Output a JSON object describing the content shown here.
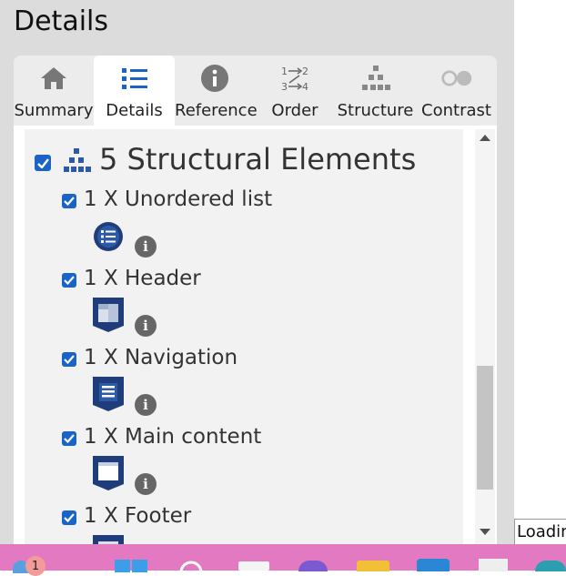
{
  "panel": {
    "title": "Details"
  },
  "tabs": [
    {
      "label": "Summary",
      "icon": "home-icon"
    },
    {
      "label": "Details",
      "icon": "list-icon",
      "active": true
    },
    {
      "label": "Reference",
      "icon": "info-icon"
    },
    {
      "label": "Order",
      "icon": "order-icon"
    },
    {
      "label": "Structure",
      "icon": "hierarchy-icon"
    },
    {
      "label": "Contrast",
      "icon": "contrast-icon"
    }
  ],
  "structure": {
    "group_title": "5 Structural Elements",
    "items": [
      {
        "label": "1 X Unordered list",
        "icon": "unordered-list-icon"
      },
      {
        "label": "1 X Header",
        "icon": "header-icon"
      },
      {
        "label": "1 X Navigation",
        "icon": "navigation-icon"
      },
      {
        "label": "1 X Main content",
        "icon": "main-content-icon"
      },
      {
        "label": "1 X Footer",
        "icon": "footer-icon"
      }
    ]
  },
  "info_glyph": "i",
  "status": {
    "loading_text": "Loadin"
  },
  "taskbar": {
    "notification_count": "1"
  },
  "colors": {
    "accent": "#1a64c8",
    "icon_navy": "#1f3d7a",
    "taskbar": "#e379c0",
    "panel_bg": "#dcdcdc"
  }
}
